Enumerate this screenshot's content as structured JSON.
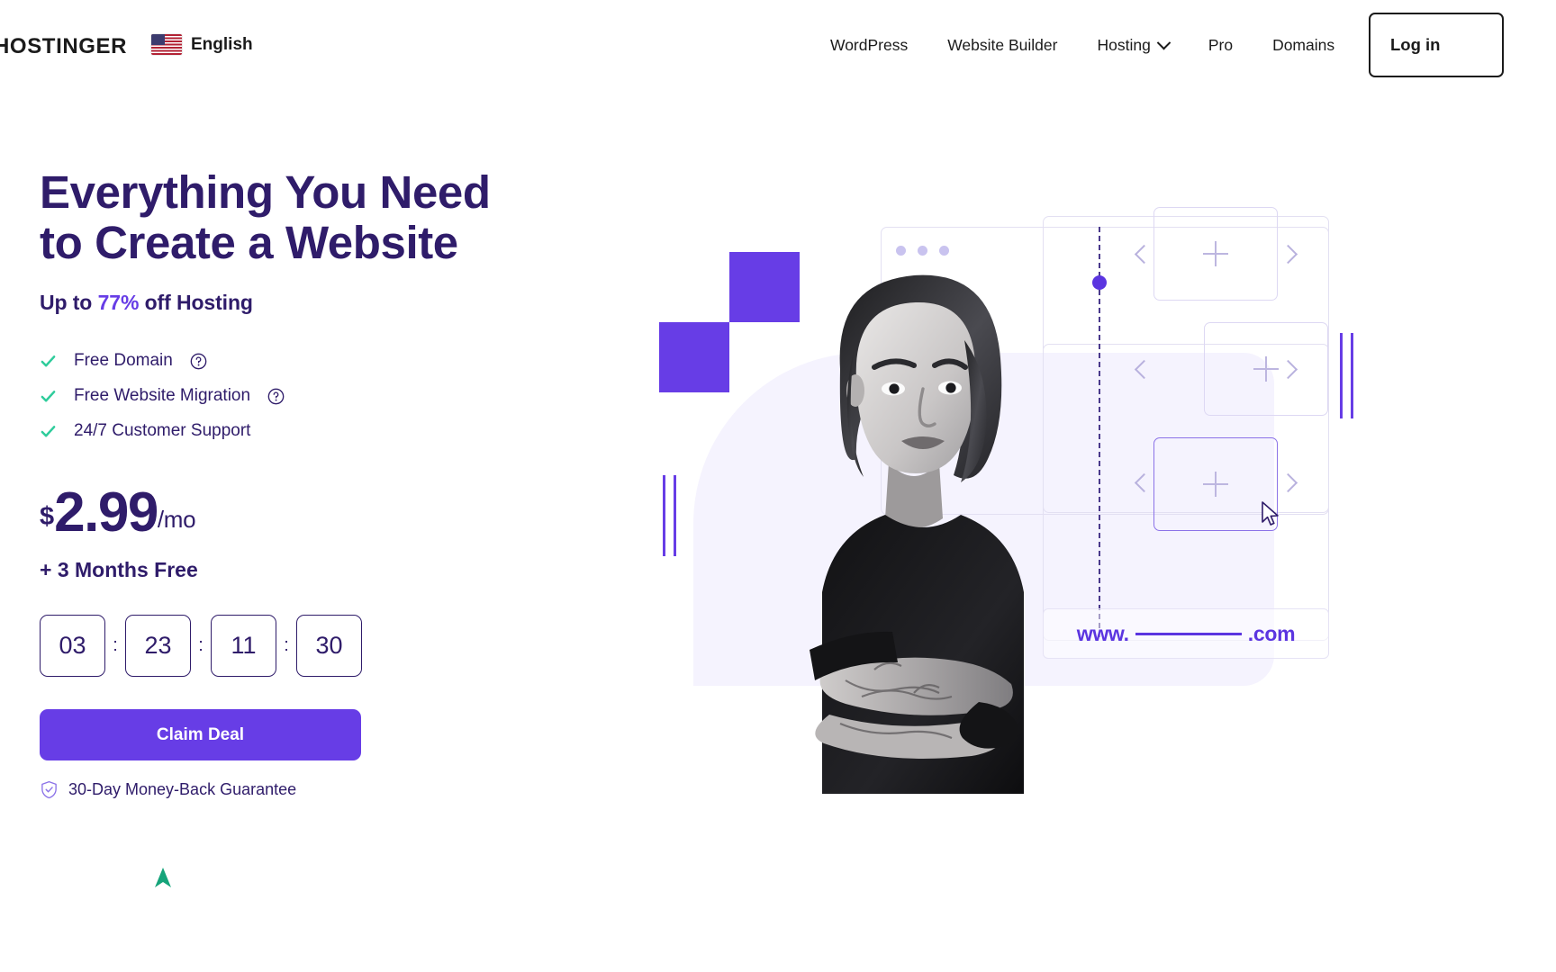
{
  "header": {
    "logo": "HOSTINGER",
    "language": {
      "label": "English",
      "flag_icon": "us-flag-icon"
    },
    "nav": [
      {
        "label": "WordPress",
        "has_dropdown": false
      },
      {
        "label": "Website Builder",
        "has_dropdown": false
      },
      {
        "label": "Hosting",
        "has_dropdown": true
      },
      {
        "label": "Pro",
        "has_dropdown": false
      },
      {
        "label": "Domains",
        "has_dropdown": false
      }
    ],
    "login_button": "Log in"
  },
  "hero": {
    "title": "Everything You Need to Create a Website",
    "subtitle_prefix": "Up to ",
    "subtitle_percent": "77%",
    "subtitle_suffix": " off Hosting",
    "features": [
      {
        "label": "Free Domain",
        "has_tooltip": true
      },
      {
        "label": "Free Website Migration",
        "has_tooltip": true
      },
      {
        "label": "24/7 Customer Support",
        "has_tooltip": false
      }
    ],
    "price": {
      "currency": "$",
      "amount": "2.99",
      "period": "/mo"
    },
    "bonus": "+ 3 Months Free",
    "countdown": {
      "days": "03",
      "hours": "23",
      "minutes": "11",
      "seconds": "30",
      "separator": ":"
    },
    "cta_button": "Claim Deal",
    "guarantee": {
      "label": "30-Day Money-Back Guarantee",
      "icon": "shield-check-icon"
    }
  },
  "illustration": {
    "url_preview": {
      "prefix": "www.",
      "suffix": ".com"
    },
    "card_icon": "plus-icon",
    "prev_arrow": "chevron-left-icon",
    "next_arrow": "chevron-right-icon",
    "cursor": "mouse-pointer-icon",
    "window_dots": "traffic-light-dots"
  },
  "colors": {
    "brand_purple": "#673DE6",
    "dark_purple": "#2F1C6A",
    "accent_violet": "#5B35E0",
    "check_green": "#2ECC9B",
    "soft_lavender": "#F5F3FE",
    "text_dark": "#1B1B1B"
  }
}
